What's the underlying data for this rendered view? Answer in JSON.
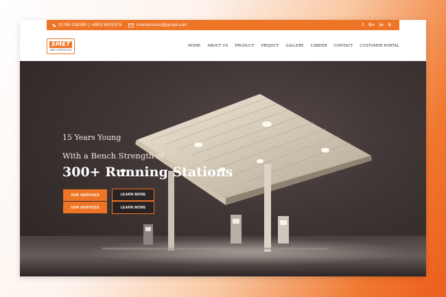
{
  "topbar": {
    "phone": "01765 038390 | +8802 8001576",
    "email": "smetservices@gmail.com",
    "social": [
      "f",
      "G+",
      "in",
      "S"
    ]
  },
  "logo": {
    "main": "SMET",
    "sub": "SMET SERVICES"
  },
  "nav": {
    "items": [
      "HOME",
      "ABOUT US",
      "PRODUCT",
      "PROJECT",
      "GALLERY",
      "CAREER",
      "CONTACT",
      "CUSTOMER PORTAL"
    ]
  },
  "hero": {
    "line1": "15 Years Young",
    "line2": "With a Bench Strength of",
    "headline": "300+ Running Stations",
    "buttons": [
      {
        "primary": "OUR SERVICES",
        "secondary": "LEARN MORE"
      },
      {
        "primary": "OUR SERVICES",
        "secondary": "LEARN MORE"
      }
    ]
  },
  "colors": {
    "accent": "#ee7426",
    "hero_bg": "#3e3434"
  }
}
